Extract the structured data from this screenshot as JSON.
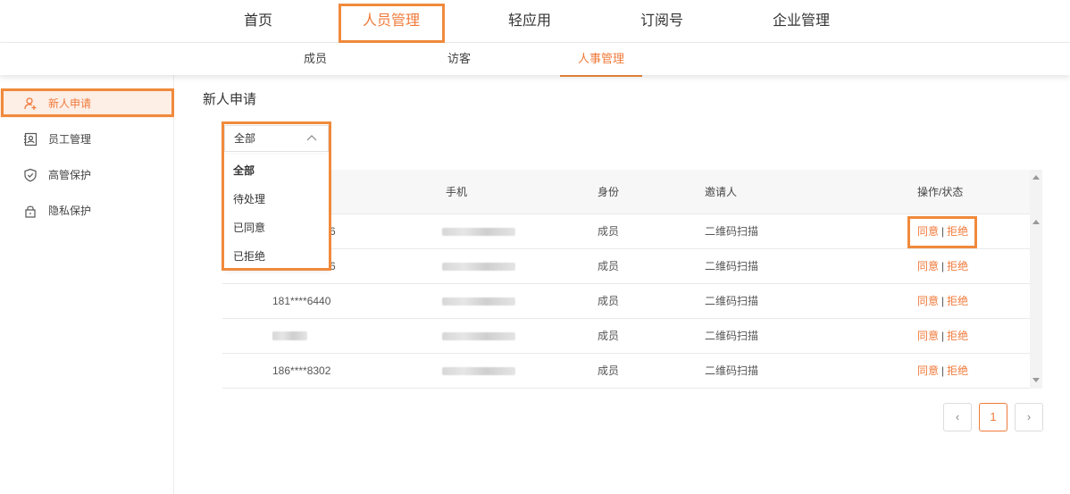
{
  "topnav": {
    "items": [
      {
        "label": "首页"
      },
      {
        "label": "人员管理",
        "active": true
      },
      {
        "label": "轻应用"
      },
      {
        "label": "订阅号"
      },
      {
        "label": "企业管理"
      }
    ]
  },
  "subnav": {
    "items": [
      {
        "label": "成员"
      },
      {
        "label": "访客"
      },
      {
        "label": "人事管理",
        "active": true
      }
    ]
  },
  "sidebar": {
    "items": [
      {
        "label": "新人申请",
        "icon": "user-add-icon",
        "active": true
      },
      {
        "label": "员工管理",
        "icon": "id-card-icon"
      },
      {
        "label": "高管保护",
        "icon": "shield-icon"
      },
      {
        "label": "隐私保护",
        "icon": "lock-icon"
      }
    ]
  },
  "main": {
    "title": "新人申请",
    "filter": {
      "selected": "全部",
      "options": [
        "全部",
        "待处理",
        "已同意",
        "已拒绝"
      ]
    },
    "table": {
      "columns": [
        "手机",
        "身份",
        "邀请人",
        "操作/状态"
      ],
      "rows": [
        {
          "name": "6",
          "role": "成员",
          "inviter": "二维码扫描",
          "agree": "同意",
          "reject": "拒绝"
        },
        {
          "name": "6",
          "role": "成员",
          "inviter": "二维码扫描",
          "agree": "同意",
          "reject": "拒绝"
        },
        {
          "name": "181****6440",
          "role": "成员",
          "inviter": "二维码扫描",
          "agree": "同意",
          "reject": "拒绝"
        },
        {
          "name": "",
          "role": "成员",
          "inviter": "二维码扫描",
          "agree": "同意",
          "reject": "拒绝"
        },
        {
          "name": "186****8302",
          "role": "成员",
          "inviter": "二维码扫描",
          "agree": "同意",
          "reject": "拒绝"
        }
      ],
      "separator": "|"
    },
    "pagination": {
      "prev": "‹",
      "current": "1",
      "next": "›"
    }
  },
  "colors": {
    "accent": "#f07a3a",
    "highlight_box": "#f08a3c"
  }
}
